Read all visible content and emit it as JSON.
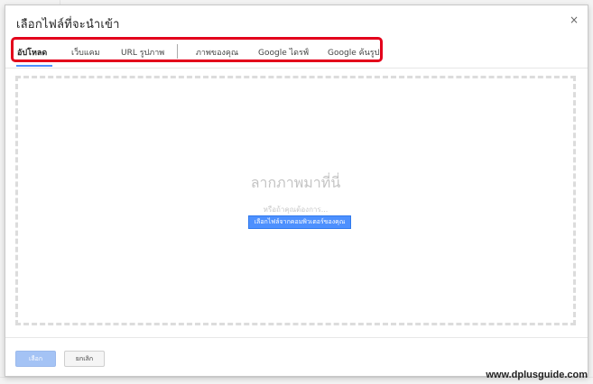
{
  "dialog": {
    "title": "เลือกไฟล์ที่จะนำเข้า",
    "close_symbol": "×"
  },
  "tabs": [
    {
      "label": "อัปโหลด",
      "active": true
    },
    {
      "label": "เว็บแคม",
      "active": false
    },
    {
      "label": "URL รูปภาพ",
      "active": false
    },
    {
      "label": "ภาพของคุณ",
      "active": false
    },
    {
      "label": "Google ไดรฟ์",
      "active": false
    },
    {
      "label": "Google ค้นรูป",
      "active": false
    }
  ],
  "dropzone": {
    "title": "ลากภาพมาที่นี่",
    "subtitle": "หรือถ้าคุณต้องการ...",
    "button_label": "เลือกไฟล์จากคอมพิวเตอร์ของคุณ"
  },
  "footer": {
    "select_label": "เลือก",
    "cancel_label": "ยกเลิก"
  },
  "watermark": "www.dplusguide.com",
  "colors": {
    "accent": "#4d90fe",
    "highlight_box": "#e3001b",
    "disabled_button": "#a4c3f5"
  },
  "icons": {
    "close": "close-icon"
  }
}
